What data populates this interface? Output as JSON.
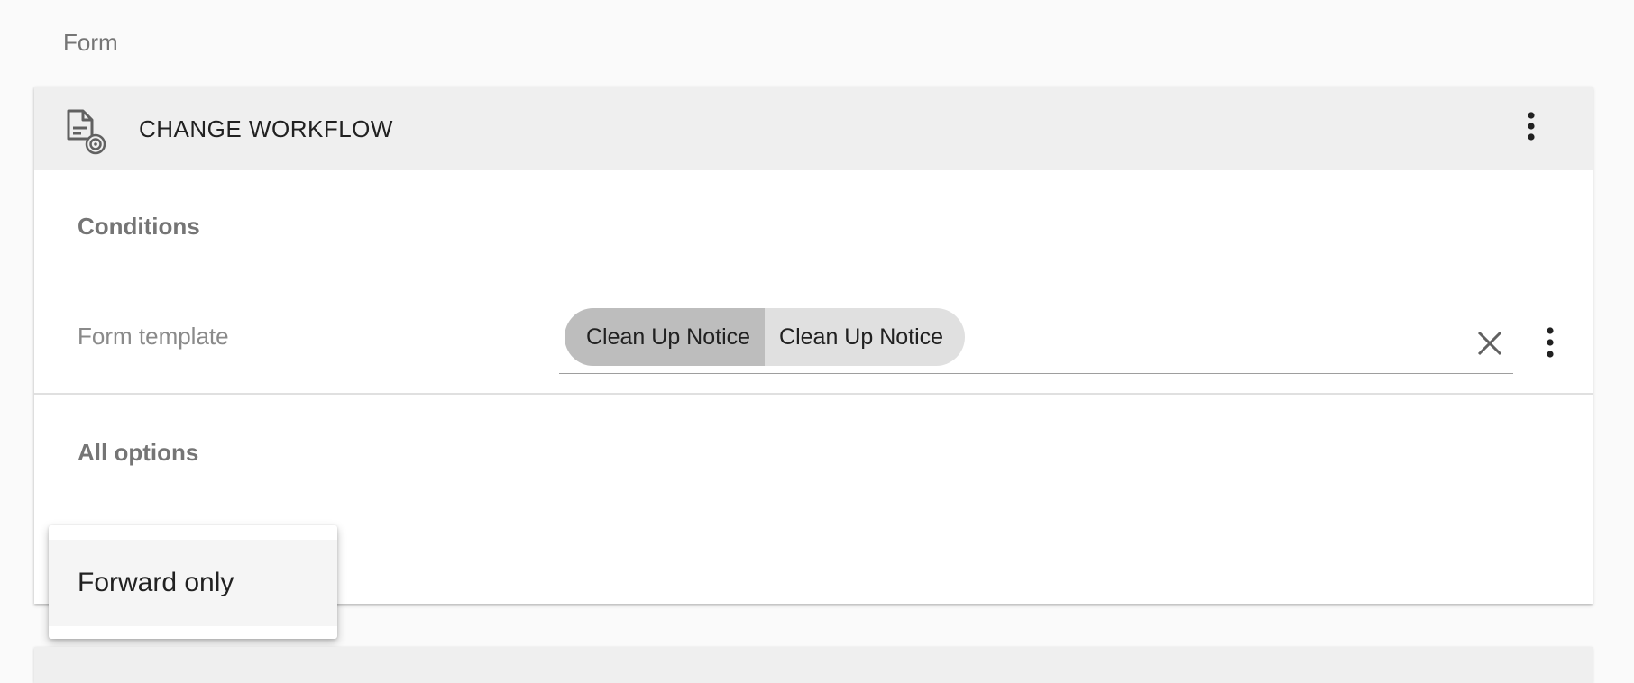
{
  "page": {
    "section_label": "Form"
  },
  "card": {
    "title": "CHANGE WORKFLOW",
    "header_icon": "form-workflow-icon",
    "menu_icon": "more-vert-icon",
    "conditions_title": "Conditions",
    "form_template": {
      "label": "Form template",
      "chip": {
        "left_label": "Clean Up Notice",
        "right_label": "Clean Up Notice"
      },
      "clear_icon": "close-icon",
      "menu_icon": "more-vert-icon"
    },
    "options_title": "All options"
  },
  "dropdown": {
    "items": [
      {
        "label": "Forward only"
      }
    ]
  },
  "colors": {
    "background": "#fafafa",
    "header_background": "#efefef",
    "chip_left": "#bdbdbd",
    "chip_right": "#e0e0e0",
    "muted_text": "#757575",
    "primary_text": "#212121"
  }
}
